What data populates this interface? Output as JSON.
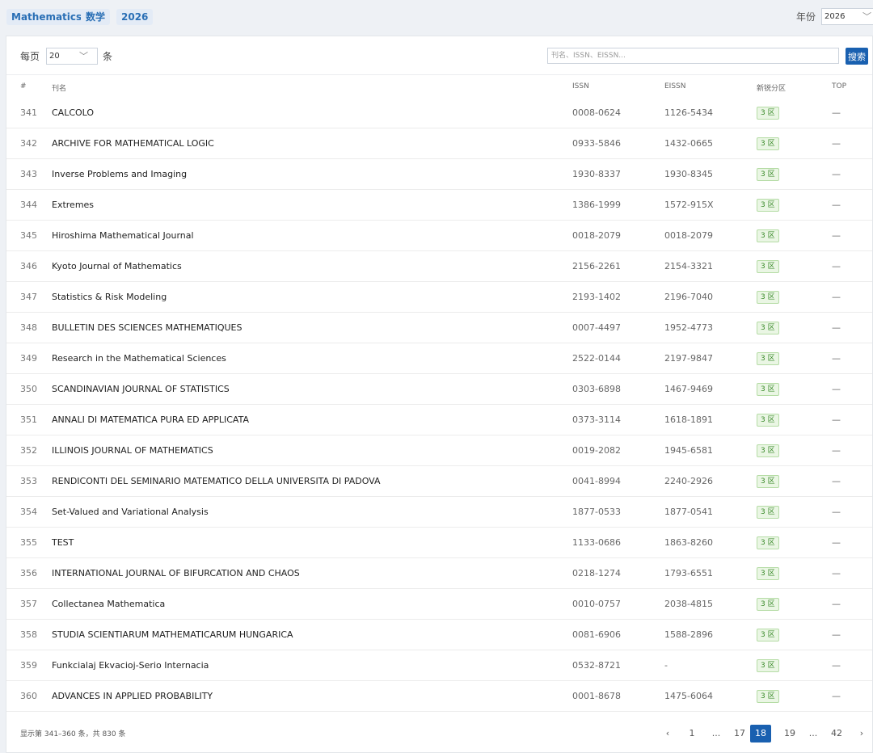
{
  "header": {
    "tags": [
      "Mathematics",
      "数学",
      "2026"
    ],
    "year_label": "年份",
    "year_value": "2026"
  },
  "controls": {
    "per_page_label": "每页",
    "per_page_value": "20",
    "per_page_suffix": "条",
    "search_placeholder": "刊名、ISSN、EISSN...",
    "search_button": "搜索"
  },
  "table": {
    "columns": [
      "#",
      "刊名",
      "ISSN",
      "EISSN",
      "新锐分区",
      "TOP"
    ],
    "rows": [
      {
        "num": "341",
        "name": "CALCOLO",
        "issn": "0008-0624",
        "eissn": "1126-5434",
        "zone": "3 区",
        "top": "—"
      },
      {
        "num": "342",
        "name": "ARCHIVE FOR MATHEMATICAL LOGIC",
        "issn": "0933-5846",
        "eissn": "1432-0665",
        "zone": "3 区",
        "top": "—"
      },
      {
        "num": "343",
        "name": "Inverse Problems and Imaging",
        "issn": "1930-8337",
        "eissn": "1930-8345",
        "zone": "3 区",
        "top": "—"
      },
      {
        "num": "344",
        "name": "Extremes",
        "issn": "1386-1999",
        "eissn": "1572-915X",
        "zone": "3 区",
        "top": "—"
      },
      {
        "num": "345",
        "name": "Hiroshima Mathematical Journal",
        "issn": "0018-2079",
        "eissn": "0018-2079",
        "zone": "3 区",
        "top": "—"
      },
      {
        "num": "346",
        "name": "Kyoto Journal of Mathematics",
        "issn": "2156-2261",
        "eissn": "2154-3321",
        "zone": "3 区",
        "top": "—"
      },
      {
        "num": "347",
        "name": "Statistics & Risk Modeling",
        "issn": "2193-1402",
        "eissn": "2196-7040",
        "zone": "3 区",
        "top": "—"
      },
      {
        "num": "348",
        "name": "BULLETIN DES SCIENCES MATHEMATIQUES",
        "issn": "0007-4497",
        "eissn": "1952-4773",
        "zone": "3 区",
        "top": "—"
      },
      {
        "num": "349",
        "name": "Research in the Mathematical Sciences",
        "issn": "2522-0144",
        "eissn": "2197-9847",
        "zone": "3 区",
        "top": "—"
      },
      {
        "num": "350",
        "name": "SCANDINAVIAN JOURNAL OF STATISTICS",
        "issn": "0303-6898",
        "eissn": "1467-9469",
        "zone": "3 区",
        "top": "—"
      },
      {
        "num": "351",
        "name": "ANNALI DI MATEMATICA PURA ED APPLICATA",
        "issn": "0373-3114",
        "eissn": "1618-1891",
        "zone": "3 区",
        "top": "—"
      },
      {
        "num": "352",
        "name": "ILLINOIS JOURNAL OF MATHEMATICS",
        "issn": "0019-2082",
        "eissn": "1945-6581",
        "zone": "3 区",
        "top": "—"
      },
      {
        "num": "353",
        "name": "RENDICONTI DEL SEMINARIO MATEMATICO DELLA UNIVERSITA DI PADOVA",
        "issn": "0041-8994",
        "eissn": "2240-2926",
        "zone": "3 区",
        "top": "—"
      },
      {
        "num": "354",
        "name": "Set-Valued and Variational Analysis",
        "issn": "1877-0533",
        "eissn": "1877-0541",
        "zone": "3 区",
        "top": "—"
      },
      {
        "num": "355",
        "name": "TEST",
        "issn": "1133-0686",
        "eissn": "1863-8260",
        "zone": "3 区",
        "top": "—"
      },
      {
        "num": "356",
        "name": "INTERNATIONAL JOURNAL OF BIFURCATION AND CHAOS",
        "issn": "0218-1274",
        "eissn": "1793-6551",
        "zone": "3 区",
        "top": "—"
      },
      {
        "num": "357",
        "name": "Collectanea Mathematica",
        "issn": "0010-0757",
        "eissn": "2038-4815",
        "zone": "3 区",
        "top": "—"
      },
      {
        "num": "358",
        "name": "STUDIA SCIENTIARUM MATHEMATICARUM HUNGARICA",
        "issn": "0081-6906",
        "eissn": "1588-2896",
        "zone": "3 区",
        "top": "—"
      },
      {
        "num": "359",
        "name": "Funkcialaj Ekvacioj-Serio Internacia",
        "issn": "0532-8721",
        "eissn": "-",
        "zone": "3 区",
        "top": "—"
      },
      {
        "num": "360",
        "name": "ADVANCES IN APPLIED PROBABILITY",
        "issn": "0001-8678",
        "eissn": "1475-6064",
        "zone": "3 区",
        "top": "—"
      }
    ]
  },
  "footer": {
    "summary": "显示第 341–360 条，共 830 条",
    "pages": [
      "‹",
      "1",
      "...",
      "17",
      "18",
      "19",
      "...",
      "42",
      "›"
    ],
    "current_page": "18"
  },
  "colors": {
    "accent": "#1960b0",
    "zone_bg": "#eaf6e4",
    "zone_text": "#3a8a2a"
  }
}
